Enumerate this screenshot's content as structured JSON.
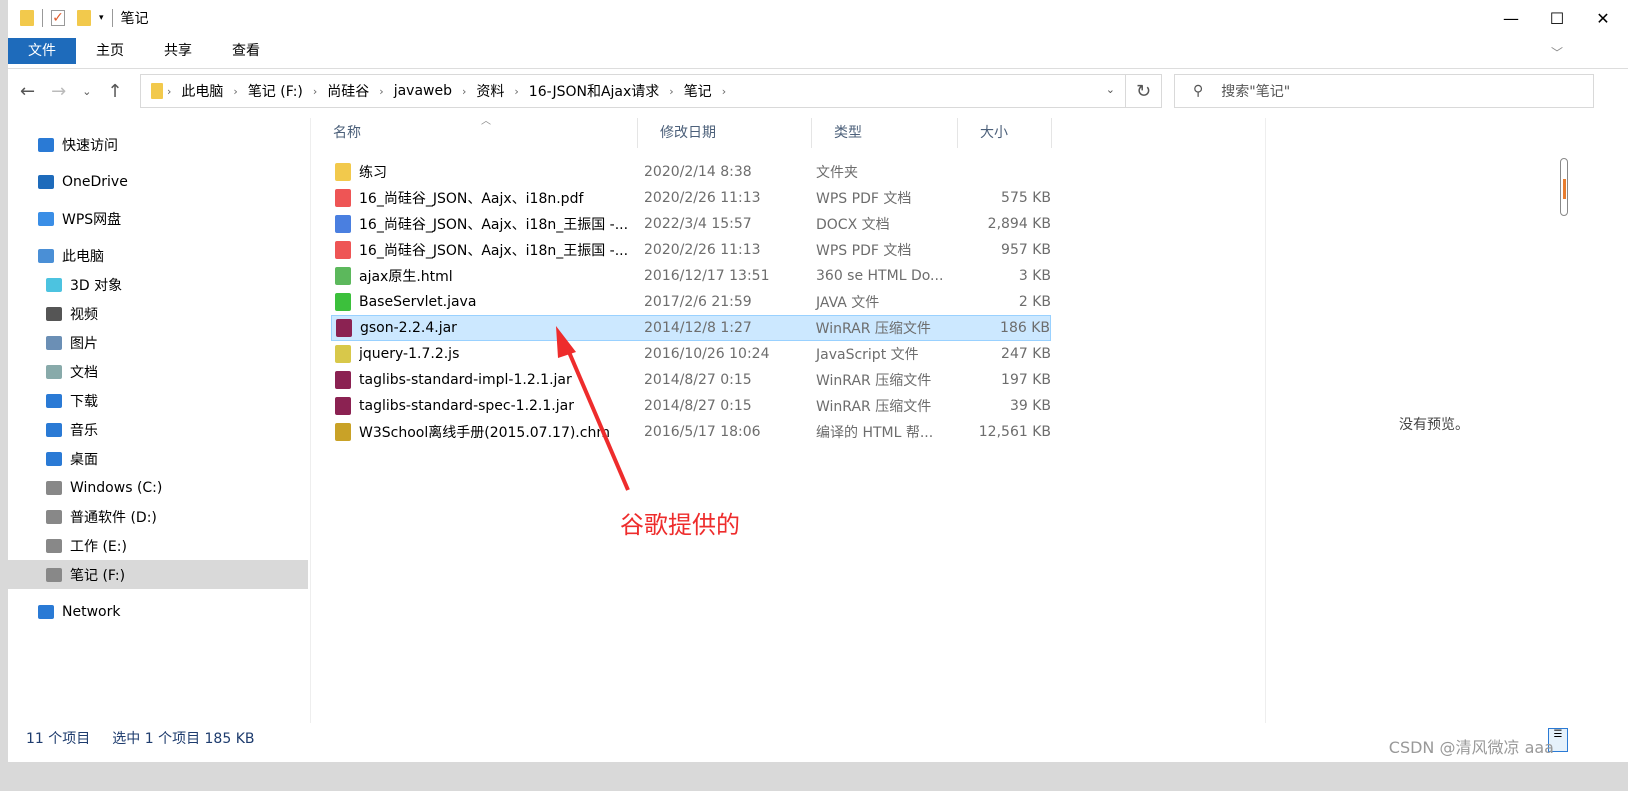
{
  "window": {
    "title": "笔记",
    "minimize": "—",
    "maximize": "☐",
    "close": "✕"
  },
  "ribbon": {
    "tabs": [
      "文件",
      "主页",
      "共享",
      "查看"
    ]
  },
  "address": {
    "crumbs": [
      "此电脑",
      "笔记 (F:)",
      "尚硅谷",
      "javaweb",
      "资料",
      "16-JSON和Ajax请求",
      "笔记"
    ]
  },
  "search": {
    "placeholder": "搜索\"笔记\""
  },
  "sidebar": {
    "items": [
      {
        "label": "快速访问",
        "icon": "star-icon",
        "color": "#2a7ad5"
      },
      {
        "label": "OneDrive",
        "icon": "cloud-icon",
        "color": "#1e6bbb"
      },
      {
        "label": "WPS网盘",
        "icon": "cloud-icon",
        "color": "#3a8ee6"
      },
      {
        "label": "此电脑",
        "icon": "computer-icon",
        "color": "#4a8fd6"
      },
      {
        "label": "3D 对象",
        "icon": "cube-icon",
        "color": "#4cc3e0"
      },
      {
        "label": "视频",
        "icon": "video-icon",
        "color": "#555"
      },
      {
        "label": "图片",
        "icon": "picture-icon",
        "color": "#6b8fb5"
      },
      {
        "label": "文档",
        "icon": "document-icon",
        "color": "#8aa"
      },
      {
        "label": "下载",
        "icon": "download-icon",
        "color": "#2a7ad5"
      },
      {
        "label": "音乐",
        "icon": "music-icon",
        "color": "#2a7ad5"
      },
      {
        "label": "桌面",
        "icon": "desktop-icon",
        "color": "#2a7ad5"
      },
      {
        "label": "Windows (C:)",
        "icon": "drive-icon",
        "color": "#888"
      },
      {
        "label": "普通软件 (D:)",
        "icon": "drive-icon",
        "color": "#888"
      },
      {
        "label": "工作 (E:)",
        "icon": "drive-icon",
        "color": "#888"
      },
      {
        "label": "笔记 (F:)",
        "icon": "drive-icon",
        "color": "#888",
        "selected": true
      },
      {
        "label": "Network",
        "icon": "network-icon",
        "color": "#2a7ad5"
      }
    ]
  },
  "columns": [
    "名称",
    "修改日期",
    "类型",
    "大小"
  ],
  "files": [
    {
      "name": "练习",
      "date": "2020/2/14 8:38",
      "type": "文件夹",
      "size": "",
      "icon": "folder-icon",
      "color": "#f2c94c"
    },
    {
      "name": "16_尚硅谷_JSON、Aajx、i18n.pdf",
      "date": "2020/2/26 11:13",
      "type": "WPS PDF 文档",
      "size": "575 KB",
      "icon": "pdf-icon",
      "color": "#e55"
    },
    {
      "name": "16_尚硅谷_JSON、Aajx、i18n_王振国 -...",
      "date": "2022/3/4 15:57",
      "type": "DOCX 文档",
      "size": "2,894 KB",
      "icon": "docx-icon",
      "color": "#4a7fe0"
    },
    {
      "name": "16_尚硅谷_JSON、Aajx、i18n_王振国 -...",
      "date": "2020/2/26 11:13",
      "type": "WPS PDF 文档",
      "size": "957 KB",
      "icon": "pdf-icon",
      "color": "#e55"
    },
    {
      "name": "ajax原生.html",
      "date": "2016/12/17 13:51",
      "type": "360 se HTML Do...",
      "size": "3 KB",
      "icon": "html-icon",
      "color": "#5cb85c"
    },
    {
      "name": "BaseServlet.java",
      "date": "2017/2/6 21:59",
      "type": "JAVA 文件",
      "size": "2 KB",
      "icon": "java-icon",
      "color": "#3cc03c"
    },
    {
      "name": "gson-2.2.4.jar",
      "date": "2014/12/8 1:27",
      "type": "WinRAR 压缩文件",
      "size": "186 KB",
      "icon": "winrar-icon",
      "color": "#8b2252",
      "selected": true
    },
    {
      "name": "jquery-1.7.2.js",
      "date": "2016/10/26 10:24",
      "type": "JavaScript 文件",
      "size": "247 KB",
      "icon": "js-icon",
      "color": "#d8c84a"
    },
    {
      "name": "taglibs-standard-impl-1.2.1.jar",
      "date": "2014/8/27 0:15",
      "type": "WinRAR 压缩文件",
      "size": "197 KB",
      "icon": "winrar-icon",
      "color": "#8b2252"
    },
    {
      "name": "taglibs-standard-spec-1.2.1.jar",
      "date": "2014/8/27 0:15",
      "type": "WinRAR 压缩文件",
      "size": "39 KB",
      "icon": "winrar-icon",
      "color": "#8b2252"
    },
    {
      "name": "W3School离线手册(2015.07.17).chm",
      "date": "2016/5/17 18:06",
      "type": "编译的 HTML 帮...",
      "size": "12,561 KB",
      "icon": "chm-icon",
      "color": "#c9a227"
    }
  ],
  "preview": {
    "text": "没有预览。"
  },
  "status": {
    "count": "11 个项目",
    "selection": "选中 1 个项目  185 KB"
  },
  "annotation": {
    "text": "谷歌提供的",
    "color": "#ee2c2c"
  },
  "watermark": "CSDN @清风微凉 aaa"
}
